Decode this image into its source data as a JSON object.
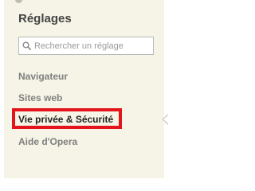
{
  "settings": {
    "title": "Réglages",
    "search": {
      "placeholder": "Rechercher un réglage",
      "value": ""
    },
    "nav": {
      "items": [
        {
          "label": "Navigateur",
          "selected": false
        },
        {
          "label": "Sites web",
          "selected": false
        },
        {
          "label": "Vie privée & Sécurité",
          "selected": true
        },
        {
          "label": "Aide d'Opera",
          "selected": false
        }
      ]
    },
    "icons": {
      "search": "search-icon",
      "selected_indicator": "arrow-left-icon"
    },
    "colors": {
      "panel_background": "#f6f4e6",
      "highlight_border": "#e3141b",
      "nav_text": "#7f7f7f",
      "nav_text_selected": "#222222"
    }
  }
}
